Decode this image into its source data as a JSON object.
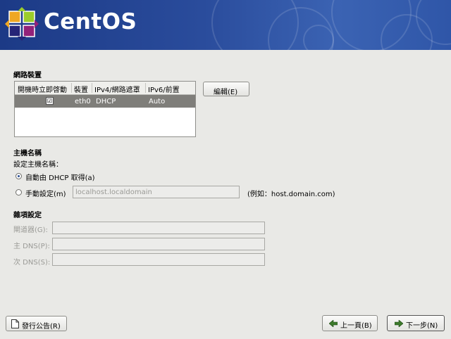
{
  "banner": {
    "brand": "CentOS"
  },
  "network_devices": {
    "title": "網路裝置",
    "columns": [
      "開機時立即啓動",
      "裝置",
      "IPv4/網路遮罩",
      "IPv6/前置"
    ],
    "rows": [
      {
        "active": "☑",
        "device": "eth0",
        "ipv4": "DHCP",
        "ipv6": "Auto"
      }
    ],
    "edit_button": "編輯(E)"
  },
  "hostname": {
    "title": "主機名稱",
    "subtitle": "設定主機名稱：",
    "auto_option": "自動由 DHCP 取得(a)",
    "manual_option": "手動設定(m)",
    "manual_value": "localhost.localdomain",
    "example": "(例如：host.domain.com)"
  },
  "misc": {
    "title": "雜項設定",
    "gateway_label": "閘道器(G):",
    "primary_dns_label": "主 DNS(P):",
    "secondary_dns_label": "次 DNS(S):"
  },
  "footer": {
    "release_notes": "發行公告(R)",
    "back": "上一頁(B)",
    "next": "下一步(N)"
  }
}
